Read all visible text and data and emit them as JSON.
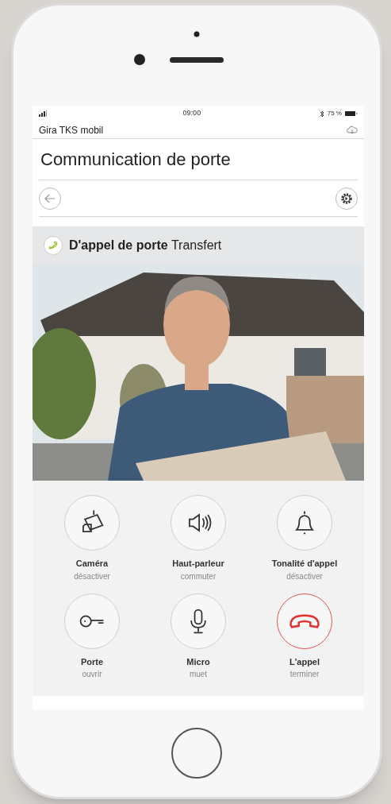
{
  "status_bar": {
    "time": "09:00",
    "battery": "75 %"
  },
  "app_name": "Gira TKS mobil",
  "title": "Communication de porte",
  "call": {
    "title": "D'appel de porte",
    "status": "Transfert"
  },
  "actions": [
    {
      "kind": "camera",
      "label": "Caméra",
      "sublabel": "désactiver"
    },
    {
      "kind": "speaker",
      "label": "Haut-parleur",
      "sublabel": "commuter"
    },
    {
      "kind": "bell",
      "label": "Tonalité d'appel",
      "sublabel": "désactiver"
    },
    {
      "kind": "key",
      "label": "Porte",
      "sublabel": "ouvrir"
    },
    {
      "kind": "mic",
      "label": "Micro",
      "sublabel": "muet"
    },
    {
      "kind": "hangup",
      "label": "L'appel",
      "sublabel": "terminer"
    }
  ]
}
